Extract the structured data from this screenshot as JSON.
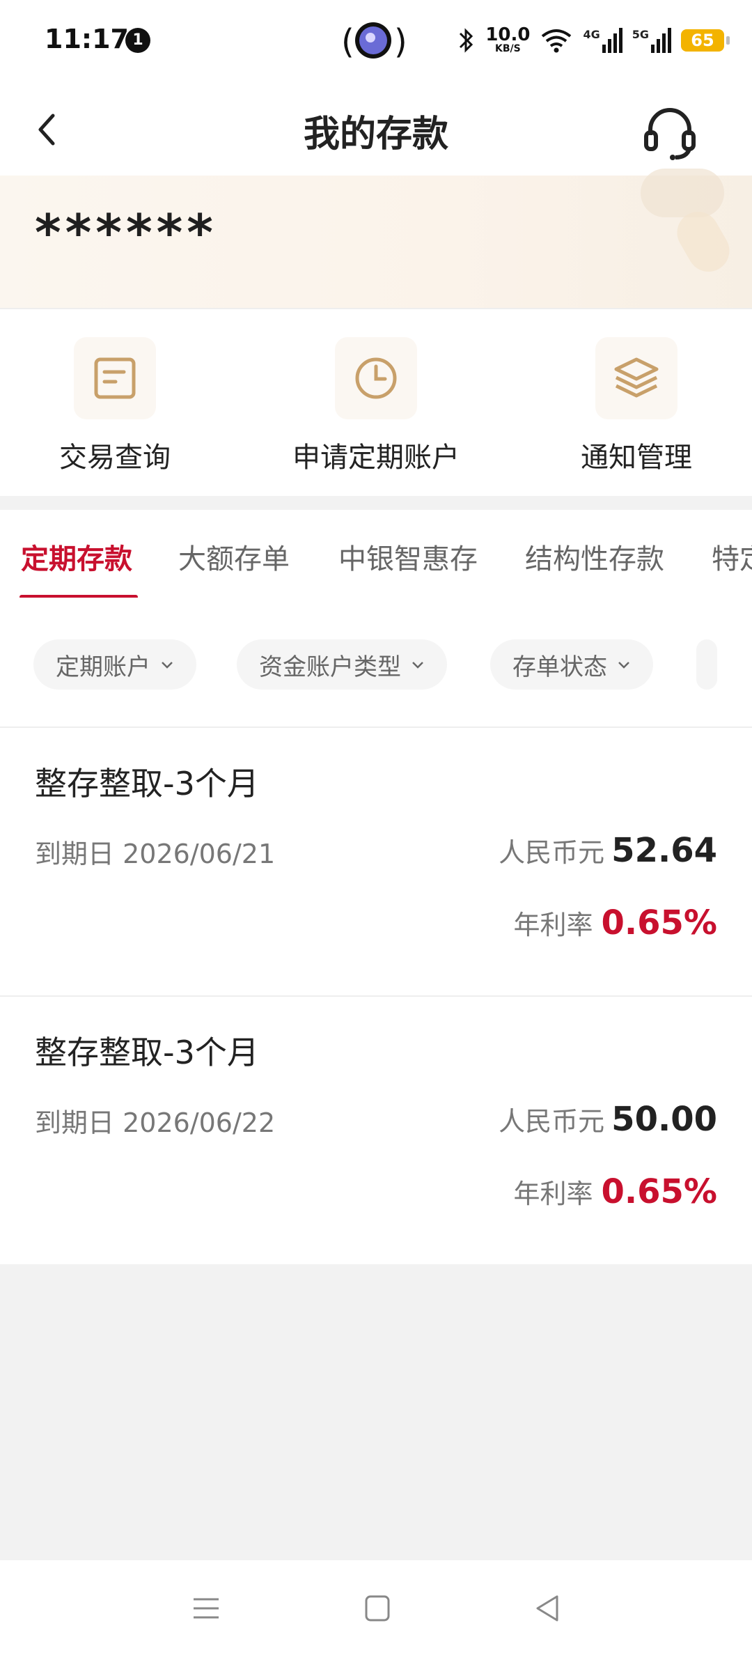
{
  "status_bar": {
    "time": "11:17",
    "notification_count": "1",
    "net_speed_value": "10.0",
    "net_speed_unit": "KB/S",
    "signal_4g": "4G",
    "signal_5g": "5G",
    "battery": "65"
  },
  "header": {
    "title": "我的存款",
    "back_icon": "chevron-left-icon",
    "support_icon": "headset-icon"
  },
  "card": {
    "balance_masked": "******"
  },
  "quick_actions": [
    {
      "label": "交易查询",
      "icon": "document-icon"
    },
    {
      "label": "申请定期账户",
      "icon": "clock-icon"
    },
    {
      "label": "通知管理",
      "icon": "layers-icon"
    }
  ],
  "tabs": [
    {
      "label": "定期存款",
      "active": true
    },
    {
      "label": "大额存单"
    },
    {
      "label": "中银智惠存"
    },
    {
      "label": "结构性存款"
    },
    {
      "label": "特定"
    }
  ],
  "filters": [
    {
      "label": "定期账户"
    },
    {
      "label": "资金账户类型"
    },
    {
      "label": "存单状态"
    }
  ],
  "deposits": [
    {
      "title": "整存整取-3个月",
      "due_label": "到期日",
      "due_date": "2026/06/21",
      "currency": "人民币元",
      "amount": "52.64",
      "rate_label": "年利率",
      "rate": "0.65%"
    },
    {
      "title": "整存整取-3个月",
      "due_label": "到期日",
      "due_date": "2026/06/22",
      "currency": "人民币元",
      "amount": "50.00",
      "rate_label": "年利率",
      "rate": "0.65%"
    }
  ],
  "colors": {
    "accent": "#c8102e",
    "icon_gold": "#c8a06a"
  }
}
